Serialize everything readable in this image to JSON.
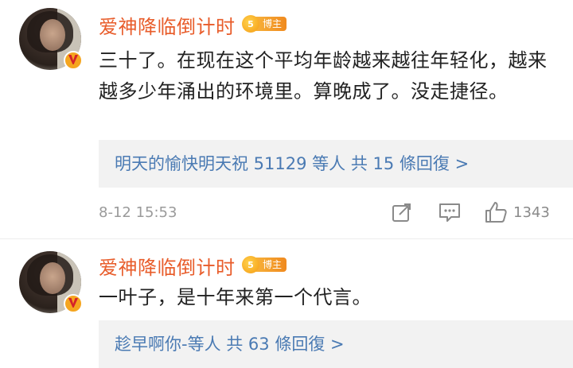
{
  "comments": [
    {
      "username": "爱神降临倒计时",
      "badge_number": "5",
      "badge_label": "博主",
      "content": "三十了。在现在这个平均年龄越来越往年轻化，越来越多少年涌出的环境里。算晚成了。没走捷径。",
      "reply_summary": "明天的愉快明天祝 51129 等人 共 15 條回復 >",
      "time": "8-12 15:53",
      "likes": "1343"
    },
    {
      "username": "爱神降临倒计时",
      "badge_number": "5",
      "badge_label": "博主",
      "content": "一叶子，是十年来第一个代言。",
      "reply_summary": "趁早啊你-等人 共 63 條回復 >"
    }
  ],
  "icons": [
    "share-icon",
    "comment-icon",
    "like-icon",
    "verified-icon",
    "blogger-medal-icon"
  ],
  "colors": {
    "username": "#e85c2a",
    "link": "#4a7ab3",
    "badge": "#f5a51f",
    "meta": "#9a9a9a"
  }
}
